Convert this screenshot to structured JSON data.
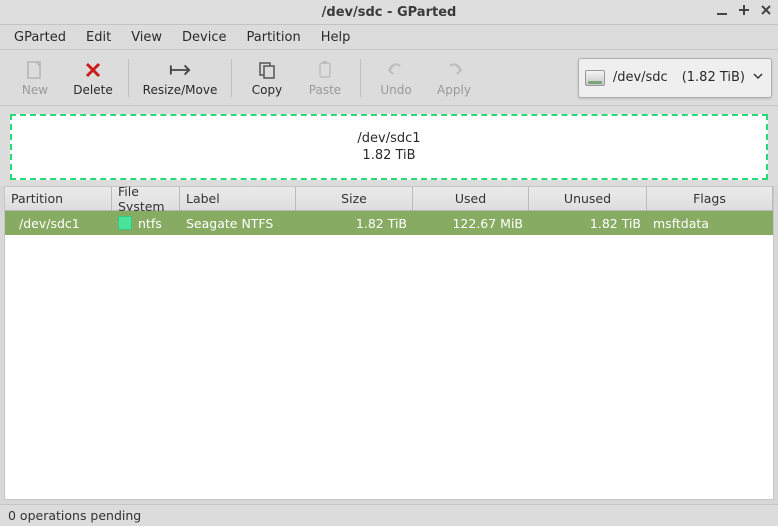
{
  "window": {
    "title": "/dev/sdc - GParted"
  },
  "menubar": {
    "items": [
      "GParted",
      "Edit",
      "View",
      "Device",
      "Partition",
      "Help"
    ]
  },
  "toolbar": {
    "new_label": "New",
    "delete_label": "Delete",
    "resize_label": "Resize/Move",
    "copy_label": "Copy",
    "paste_label": "Paste",
    "undo_label": "Undo",
    "apply_label": "Apply"
  },
  "device_selector": {
    "device": "/dev/sdc",
    "size": "(1.82 TiB)"
  },
  "graph": {
    "partition": "/dev/sdc1",
    "size": "1.82 TiB"
  },
  "table": {
    "headers": {
      "partition": "Partition",
      "filesystem": "File System",
      "label": "Label",
      "size": "Size",
      "used": "Used",
      "unused": "Unused",
      "flags": "Flags"
    },
    "rows": [
      {
        "partition": "/dev/sdc1",
        "fs": "ntfs",
        "fs_color": "#47e49a",
        "label": "Seagate NTFS",
        "size": "1.82 TiB",
        "used": "122.67 MiB",
        "unused": "1.82 TiB",
        "flags": "msftdata"
      }
    ]
  },
  "status": {
    "text": "0 operations pending"
  }
}
